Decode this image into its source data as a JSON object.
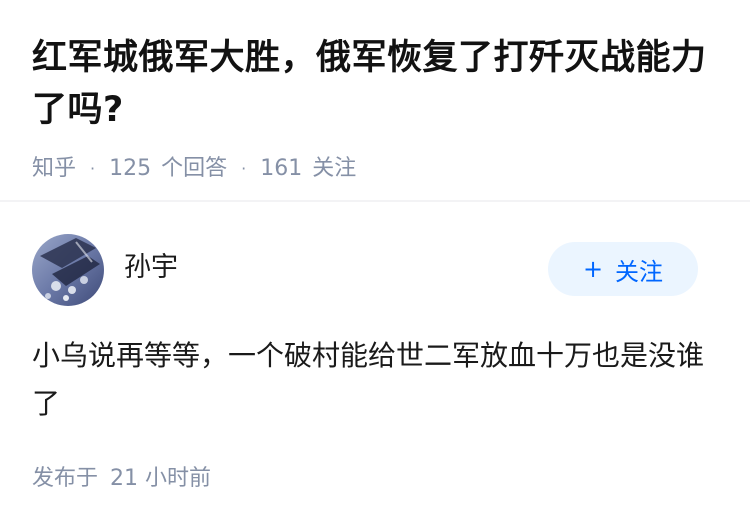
{
  "question": {
    "title": "红军城俄军大胜，俄军恢复了打歼灭战能力了吗?",
    "source": "知乎",
    "answer_count": "125",
    "answer_label": "个回答",
    "follower_count": "161",
    "follower_label": "关注",
    "separator": "·"
  },
  "author": {
    "name": "孙宇",
    "follow_label": "关注",
    "follow_icon": "plus-icon"
  },
  "answer": {
    "text": "小乌说再等等，一个破村能给世二军放血十万也是没谁了",
    "published_label": "发布于",
    "published_time": "21 小时前"
  },
  "colors": {
    "accent": "#0066ff",
    "follow_bg": "#ebf5ff",
    "meta": "#8590a6"
  }
}
